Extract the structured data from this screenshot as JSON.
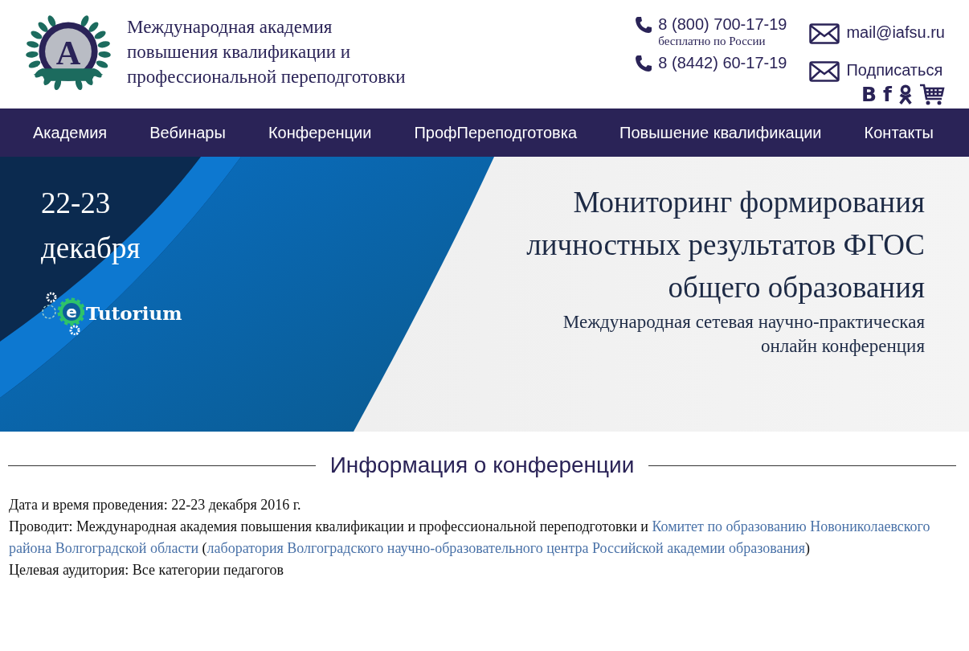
{
  "header": {
    "logo_letter": "A",
    "title_lines": [
      "Международная академия",
      "повышения квалификации и",
      "профессиональной переподготовки"
    ],
    "phones": [
      {
        "number": "8 (800) 700-17-19",
        "note": "бесплатно по России"
      },
      {
        "number": "8 (8442) 60-17-19"
      }
    ],
    "mail_links": [
      "mail@iafsu.ru",
      "Подписаться"
    ],
    "social": [
      "В",
      "f"
    ]
  },
  "nav": [
    "Академия",
    "Вебинары",
    "Конференции",
    "ПрофПереподготовка",
    "Повышение квалификации",
    "Контакты"
  ],
  "banner": {
    "date_lines": [
      "22-23",
      "декабря"
    ],
    "brand_letter": "e",
    "brand_name": "Tutorium",
    "title": "Мониторинг формирования личностных результатов ФГОС общего образования",
    "subtitle_lines": [
      "Международная сетевая научно-практическая ",
      "онлайн конференция"
    ]
  },
  "section_title": "Информация о конференции",
  "info": [
    [
      {
        "kind": "text",
        "text": "Дата и время проведения: 22-23 декабря 2016 г."
      }
    ],
    [
      {
        "kind": "text",
        "text": "Проводит: Международная академия повышения квалификации и профессиональной переподготовки и "
      },
      {
        "kind": "link",
        "text": "Комитет по образованию Новониколаевского района Волгоградской области"
      },
      {
        "kind": "text",
        "text": " ("
      },
      {
        "kind": "link",
        "text": "лаборатория Волгоградского научно-образовательного центра Российской академии образования"
      },
      {
        "kind": "text",
        "text": ")"
      }
    ],
    [
      {
        "kind": "text",
        "text": "Целевая аудитория: Все категории педагогов"
      }
    ]
  ]
}
